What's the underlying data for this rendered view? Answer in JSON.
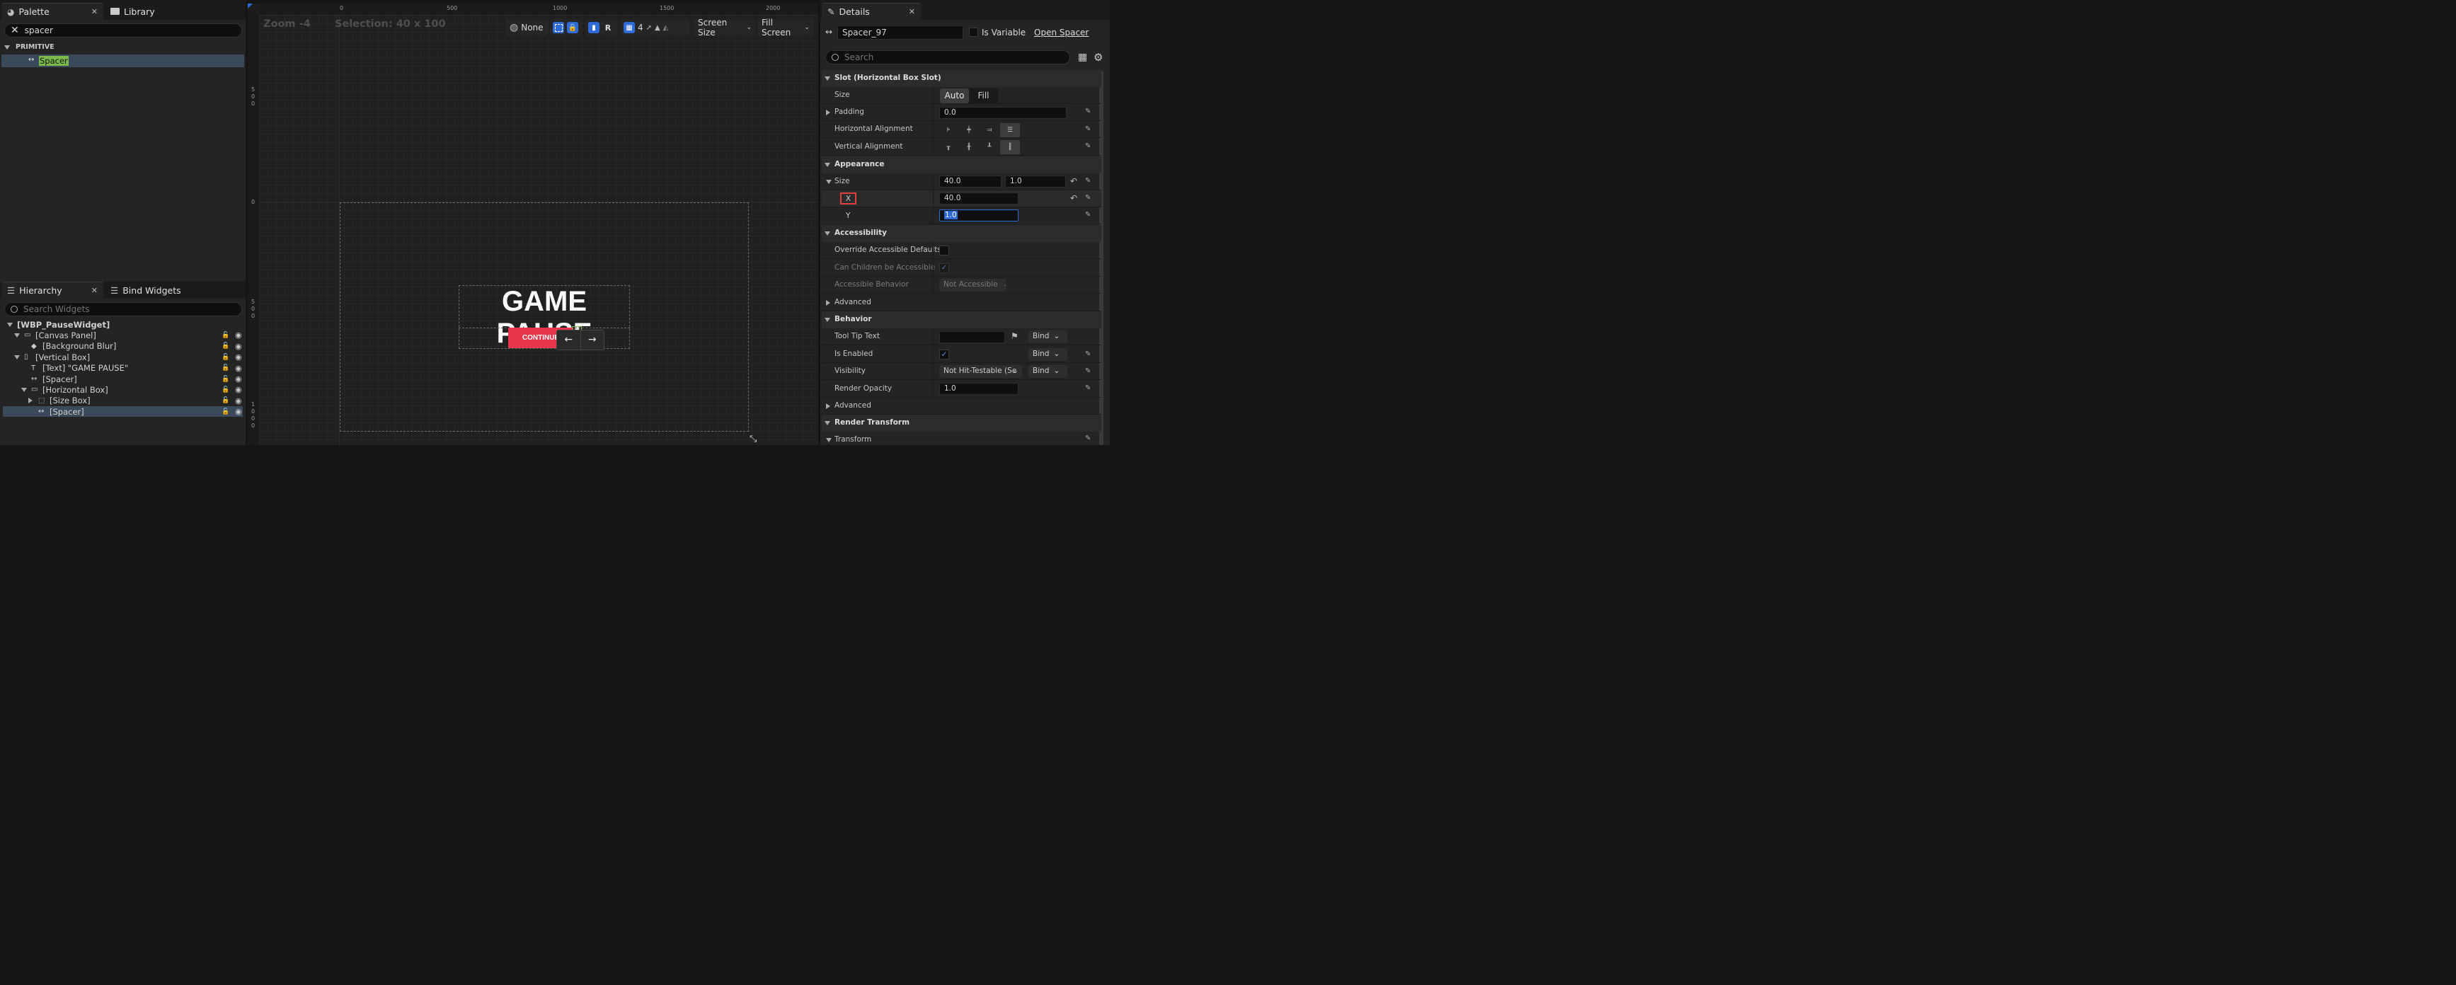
{
  "palette": {
    "tab_label": "Palette",
    "library_tab_label": "Library",
    "search_value": "spacer",
    "category": "PRIMITIVE",
    "items": [
      {
        "label": "Spacer",
        "icon": "spacer-icon"
      }
    ]
  },
  "hierarchy": {
    "tab_label": "Hierarchy",
    "bind_widgets_tab_label": "Bind Widgets",
    "search_placeholder": "Search Widgets",
    "items": [
      {
        "label": "[WBP_PauseWidget]",
        "icon": "",
        "depth": 0,
        "expand": "open",
        "root": true
      },
      {
        "label": "[Canvas Panel]",
        "icon": "canvas-panel-icon",
        "depth": 1,
        "expand": "open"
      },
      {
        "label": "[Background Blur]",
        "icon": "blur-icon",
        "depth": 2,
        "expand": "none"
      },
      {
        "label": "[Vertical Box]",
        "icon": "vertical-box-icon",
        "depth": 1,
        "expand": "open"
      },
      {
        "label": "[Text] \"GAME PAUSE\"",
        "icon": "text-icon",
        "depth": 2,
        "expand": "none"
      },
      {
        "label": "[Spacer]",
        "icon": "spacer-icon",
        "depth": 2,
        "expand": "none"
      },
      {
        "label": "[Horizontal Box]",
        "icon": "horizontal-box-icon",
        "depth": 2,
        "expand": "open"
      },
      {
        "label": "[Size Box]",
        "icon": "size-box-icon",
        "depth": 3,
        "expand": "closed"
      },
      {
        "label": "[Spacer]",
        "icon": "spacer-icon",
        "depth": 3,
        "expand": "none",
        "selected": true
      }
    ]
  },
  "designer": {
    "zoom_text": "Zoom -4",
    "selection_text": "Selection: 40 x 100",
    "ruler_top": [
      "0",
      "500",
      "1000",
      "1500",
      "2000"
    ],
    "ruler_left": [
      [
        "5",
        "0",
        "0"
      ],
      [
        "0"
      ],
      [
        "5",
        "0",
        "0"
      ],
      [
        "1",
        "0",
        "0",
        "0"
      ]
    ],
    "toolbar": {
      "world_label": "None",
      "r_label": "R",
      "grid_value": "4",
      "screen_size_label": "Screen Size",
      "fill_screen_label": "Fill Screen"
    },
    "game_title": "GAME PAUSE",
    "continue_label": "CONTINUE",
    "arrow_left": "←",
    "arrow_right": "→"
  },
  "details": {
    "tab_label": "Details",
    "name_value": "Spacer_97",
    "is_variable_label": "Is Variable",
    "open_spacer_label": "Open Spacer",
    "search_placeholder": "Search",
    "sections": {
      "slot": "Slot (Horizontal Box Slot)",
      "appearance": "Appearance",
      "accessibility": "Accessibility",
      "behavior": "Behavior",
      "render_transform": "Render Transform"
    },
    "size_label": "Size",
    "size_auto": "Auto",
    "size_fill": "Fill",
    "padding_label": "Padding",
    "padding_value": "0.0",
    "h_align_label": "Horizontal Alignment",
    "v_align_label": "Vertical Alignment",
    "app_size_label": "Size",
    "app_size_x": "40.0",
    "app_size_y": "1.0",
    "x_label": "X",
    "x_value": "40.0",
    "y_label": "Y",
    "y_value": "1.0",
    "override_label": "Override Accessible Defaults",
    "children_label": "Can Children be Accessible",
    "behavior_label": "Accessible Behavior",
    "behavior_value": "Not Accessible",
    "advanced_label": "Advanced",
    "tooltip_label": "Tool Tip Text",
    "bind_label": "Bind",
    "enabled_label": "Is Enabled",
    "visibility_label": "Visibility",
    "visibility_value": "Not Hit-Testable (Se",
    "opacity_label": "Render Opacity",
    "opacity_value": "1.0",
    "advanced2_label": "Advanced",
    "transform_label": "Transform"
  },
  "colors": {
    "accent_blue": "#2f6bd8",
    "selected_row": "#3a4a5a",
    "continue_red": "#e8364a",
    "highlight_green": "#7ab94a"
  }
}
